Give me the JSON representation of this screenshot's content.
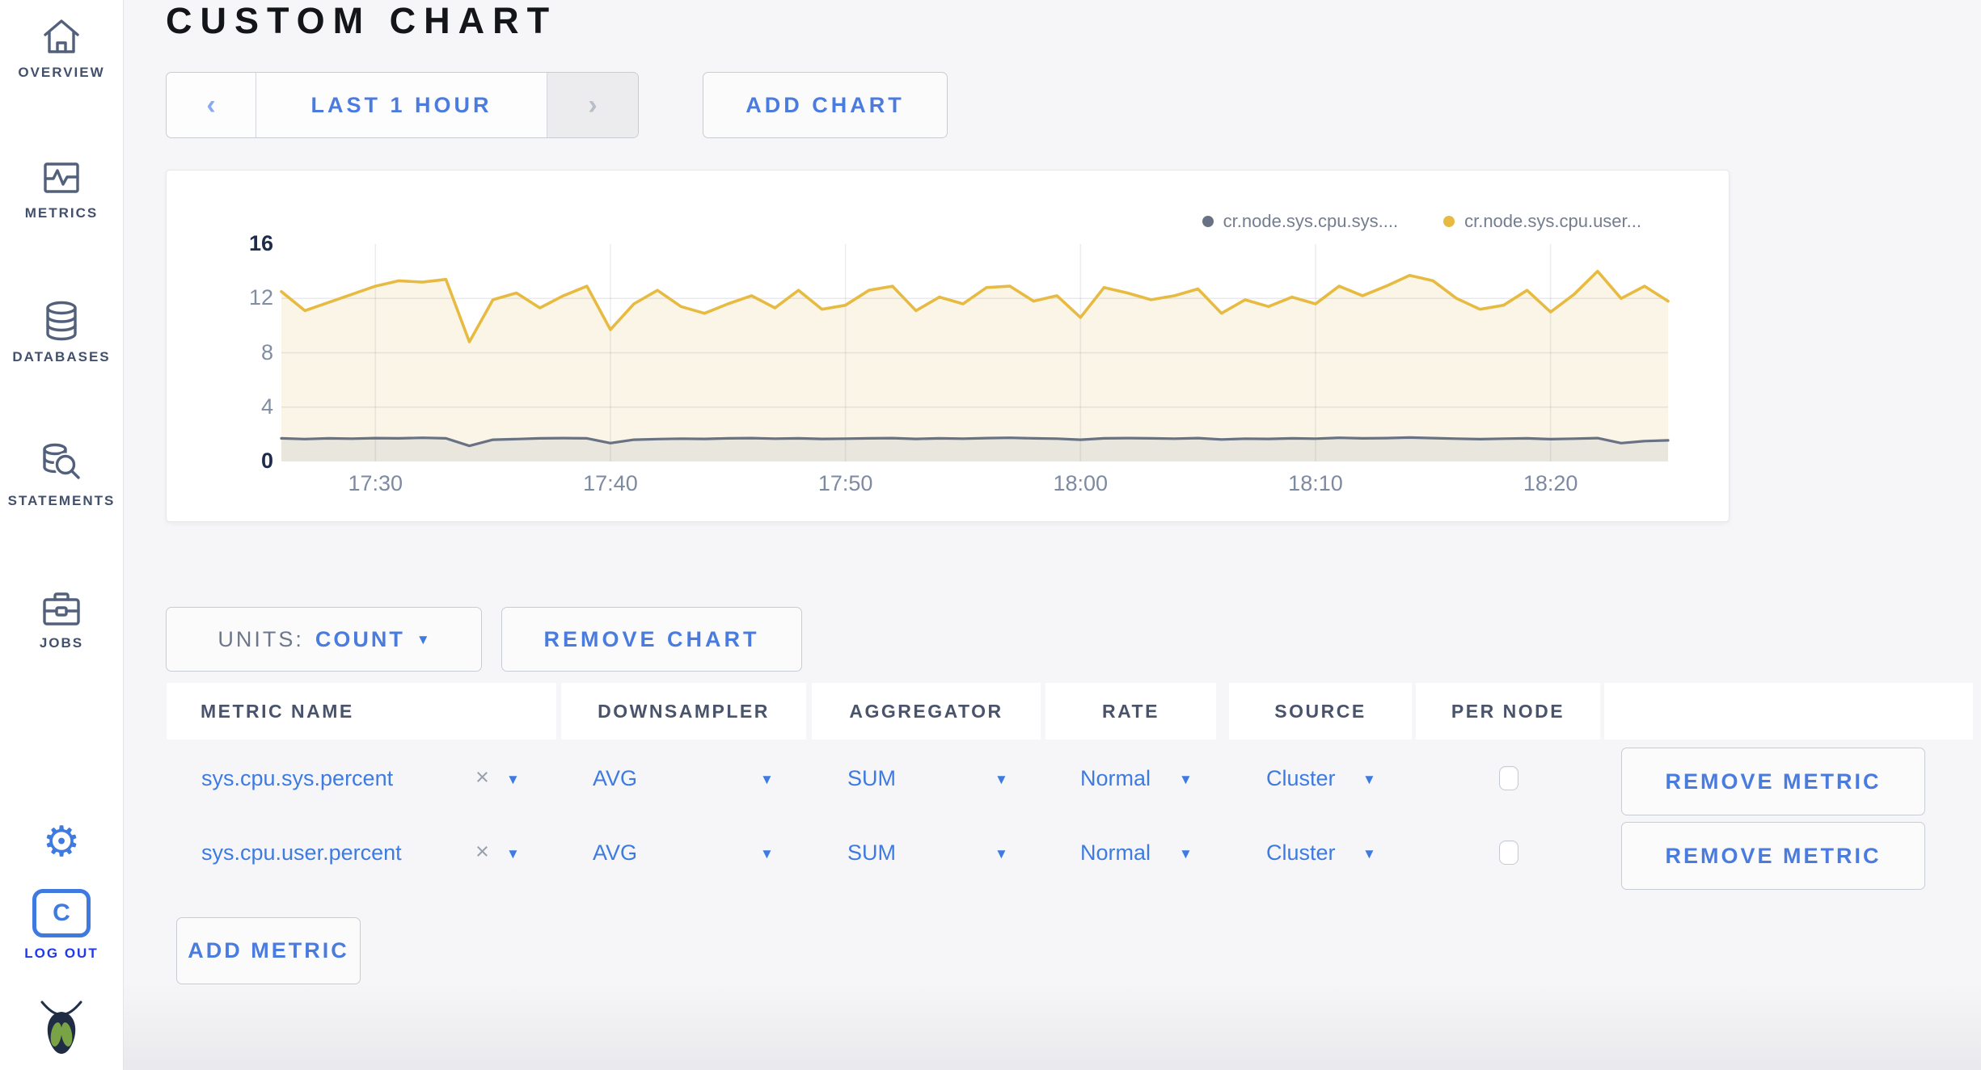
{
  "colors": {
    "accent_blue": "#3f7ae0",
    "link_blue": "#4a7ce0",
    "logout_blue": "#2038ef",
    "sidebar_slate": "#42506c",
    "page_bg": "#f6f6f8",
    "series_sys": "#687284",
    "series_user": "#e7bb41"
  },
  "sidebar": {
    "items": [
      {
        "label": "OVERVIEW"
      },
      {
        "label": "METRICS"
      },
      {
        "label": "DATABASES"
      },
      {
        "label": "STATEMENTS"
      },
      {
        "label": "JOBS"
      }
    ],
    "logout_label": "LOG OUT",
    "logout_letter": "C",
    "gear_glyph": "⚙"
  },
  "header": {
    "title": "CUSTOM CHART"
  },
  "toolbar": {
    "prev_icon": "‹",
    "time_range_label": "LAST 1 HOUR",
    "next_icon": "›",
    "add_chart_label": "ADD CHART"
  },
  "chart_data": {
    "type": "line",
    "title": "",
    "xlabel": "",
    "ylabel": "",
    "ylim": [
      0,
      16
    ],
    "y_ticks": [
      0,
      4,
      8,
      12,
      16
    ],
    "x_start": "17:26",
    "x_end": "18:25",
    "x_tick_labels": [
      "17:30",
      "17:40",
      "17:50",
      "18:00",
      "18:10",
      "18:20"
    ],
    "x_tick_minutes": [
      4,
      14,
      24,
      34,
      44,
      54
    ],
    "grid": true,
    "legend_position": "top-right",
    "series": [
      {
        "name": "cr.node.sys.cpu.sys....",
        "color": "#687284",
        "fill": "#e9e6de",
        "values": [
          1.7,
          1.65,
          1.7,
          1.68,
          1.72,
          1.7,
          1.74,
          1.7,
          1.15,
          1.6,
          1.65,
          1.7,
          1.72,
          1.7,
          1.35,
          1.6,
          1.65,
          1.68,
          1.66,
          1.7,
          1.72,
          1.68,
          1.7,
          1.66,
          1.68,
          1.7,
          1.72,
          1.66,
          1.7,
          1.68,
          1.72,
          1.74,
          1.7,
          1.68,
          1.6,
          1.7,
          1.72,
          1.7,
          1.68,
          1.72,
          1.62,
          1.68,
          1.66,
          1.7,
          1.68,
          1.74,
          1.7,
          1.72,
          1.76,
          1.72,
          1.68,
          1.64,
          1.68,
          1.7,
          1.64,
          1.68,
          1.72,
          1.35,
          1.5,
          1.55
        ]
      },
      {
        "name": "cr.node.sys.cpu.user...",
        "color": "#e7bb41",
        "fill": "#faf5e7",
        "values": [
          12.5,
          11.1,
          11.7,
          12.3,
          12.9,
          13.3,
          13.2,
          13.4,
          8.8,
          11.9,
          12.4,
          11.3,
          12.2,
          12.9,
          9.7,
          11.6,
          12.6,
          11.4,
          10.9,
          11.6,
          12.2,
          11.3,
          12.6,
          11.2,
          11.5,
          12.6,
          12.9,
          11.1,
          12.1,
          11.6,
          12.8,
          12.9,
          11.8,
          12.2,
          10.6,
          12.8,
          12.4,
          11.9,
          12.2,
          12.7,
          10.9,
          11.9,
          11.4,
          12.1,
          11.6,
          12.9,
          12.2,
          12.9,
          13.7,
          13.3,
          12.0,
          11.2,
          11.5,
          12.6,
          11.0,
          12.3,
          14.0,
          12.0,
          12.9,
          11.8
        ]
      }
    ]
  },
  "chart_controls": {
    "units_label": "UNITS:",
    "units_value": "COUNT",
    "remove_chart_label": "REMOVE CHART",
    "add_metric_label": "ADD METRIC"
  },
  "metrics_table": {
    "columns": [
      "METRIC NAME",
      "DOWNSAMPLER",
      "AGGREGATOR",
      "RATE",
      "SOURCE",
      "PER NODE"
    ],
    "rows": [
      {
        "name": "sys.cpu.sys.percent",
        "clear_icon": "×",
        "downsampler": "AVG",
        "aggregator": "SUM",
        "rate": "Normal",
        "source": "Cluster",
        "per_node_checked": false,
        "remove_label": "REMOVE METRIC"
      },
      {
        "name": "sys.cpu.user.percent",
        "clear_icon": "×",
        "downsampler": "AVG",
        "aggregator": "SUM",
        "rate": "Normal",
        "source": "Cluster",
        "per_node_checked": false,
        "remove_label": "REMOVE METRIC"
      }
    ]
  }
}
